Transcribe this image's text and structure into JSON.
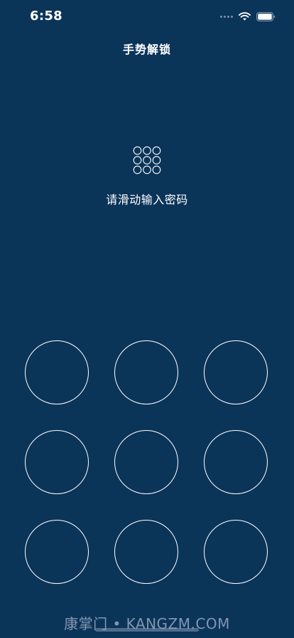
{
  "status_bar": {
    "time": "6:58",
    "icons": [
      "signal-icon",
      "wifi-icon",
      "battery-icon"
    ]
  },
  "header": {
    "title": "手势解锁"
  },
  "main": {
    "icon": "gesture-grid-icon",
    "prompt": "请滑动输入密码",
    "pattern_nodes": [
      "1",
      "2",
      "3",
      "4",
      "5",
      "6",
      "7",
      "8",
      "9"
    ]
  },
  "watermark": {
    "text": "康掌门 • KANGZM.COM"
  },
  "colors": {
    "background": "#0b3459",
    "foreground": "#ffffff"
  }
}
